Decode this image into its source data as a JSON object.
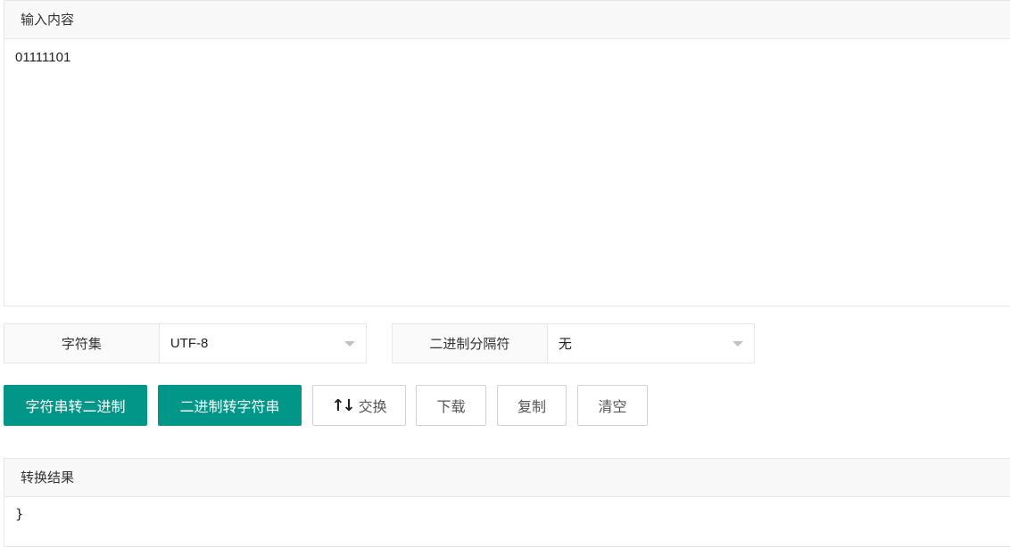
{
  "input": {
    "header": "输入内容",
    "value": "01111101"
  },
  "charset": {
    "label": "字符集",
    "selected": "UTF-8"
  },
  "separator": {
    "label": "二进制分隔符",
    "selected": "无"
  },
  "buttons": {
    "str_to_bin": "字符串转二进制",
    "bin_to_str": "二进制转字符串",
    "swap": "交换",
    "download": "下载",
    "copy": "复制",
    "clear": "清空"
  },
  "output": {
    "header": "转换结果",
    "value": "}"
  },
  "colors": {
    "primary": "#009688",
    "border": "#e6e6e6",
    "header_bg": "#f8f8f8"
  },
  "icons": {
    "swap": "swap-vertical-arrows-icon",
    "dropdown": "caret-down-icon"
  }
}
